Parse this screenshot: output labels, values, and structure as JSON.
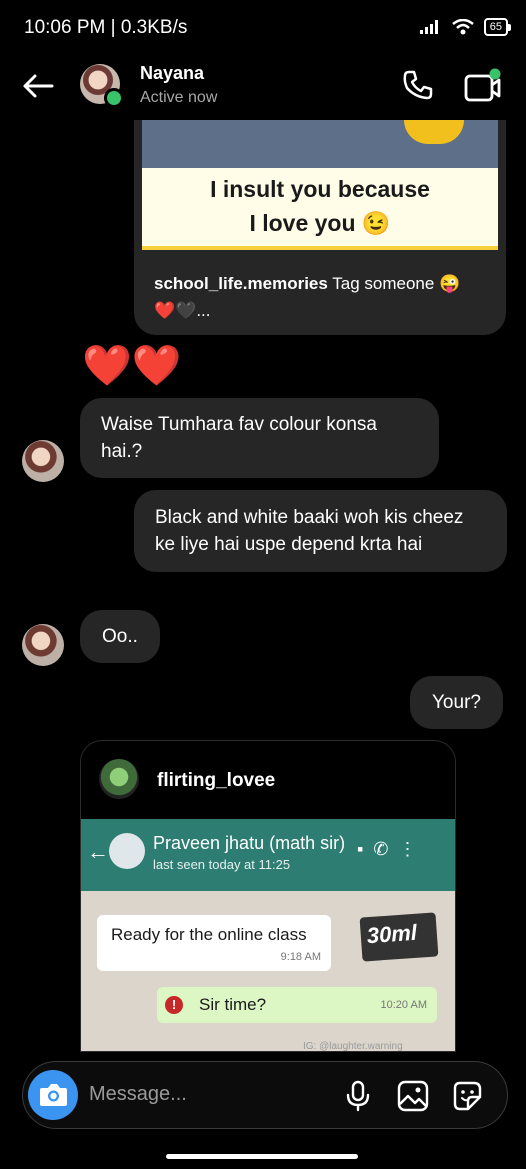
{
  "status": {
    "time": "10:06 PM | 0.3KB/s",
    "battery": "65"
  },
  "header": {
    "name": "Nayana",
    "status": "Active now"
  },
  "post1": {
    "caption_line1": "I insult you because",
    "caption_line2": "I love you 😉",
    "username": "school_life.memories",
    "text": " Tag someone 😜",
    "text2": "❤️🖤..."
  },
  "messages": {
    "hearts": "❤️❤️",
    "m1": "Waise Tumhara fav colour konsa hai.?",
    "m2": "Black and white    baaki woh kis cheez ke liye hai uspe depend krta hai",
    "m3": "Oo..",
    "m4": "Your?"
  },
  "post2": {
    "username": "flirting_lovee",
    "wa": {
      "name": "Praveen jhatu (math sir)",
      "seen": "last seen today at 11:25",
      "msg1": "Ready for the online class",
      "msg1_time": "9:18 AM",
      "sticker": "30ml",
      "msg2": "Sir time?",
      "msg2_time": "10:20 AM",
      "watermark": "IG: @laughter.warning"
    }
  },
  "composer": {
    "placeholder": "Message..."
  }
}
